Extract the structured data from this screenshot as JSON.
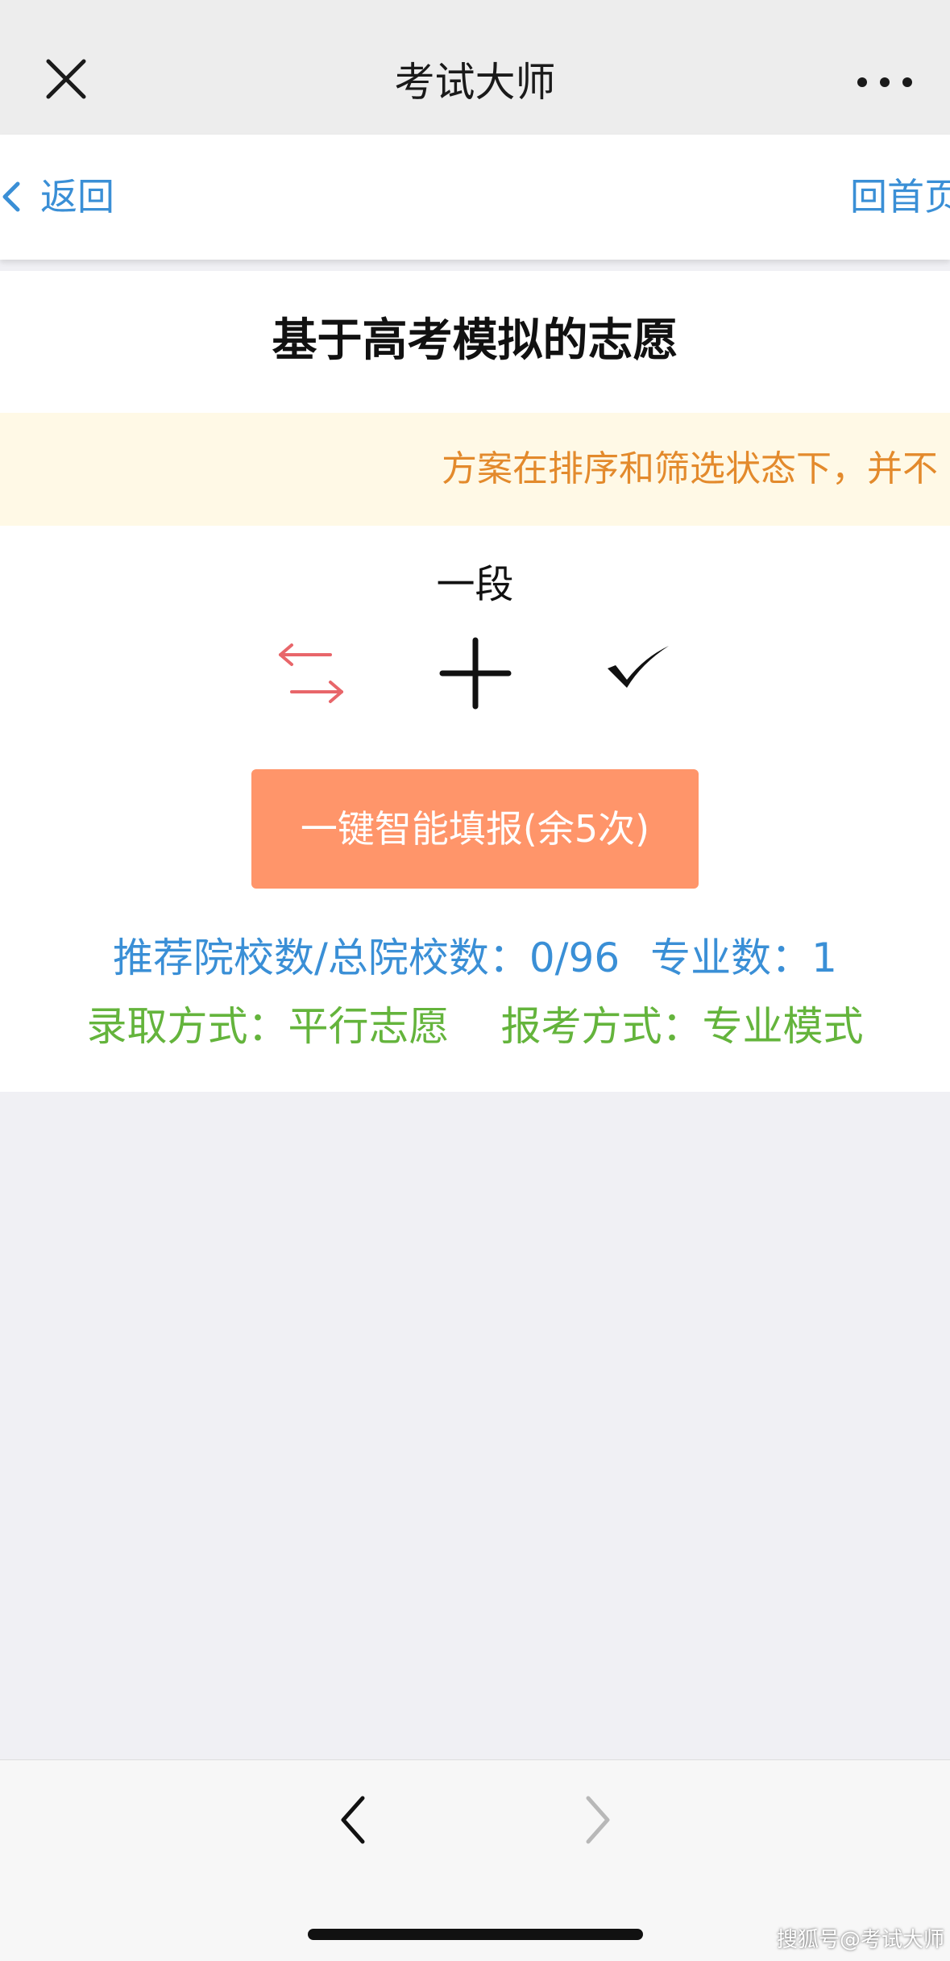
{
  "app": {
    "title": "考试大师",
    "close_icon": "close-icon",
    "more_icon": "more-dots-icon"
  },
  "nav": {
    "back_label": "返回",
    "home_label": "回首页"
  },
  "page": {
    "title": "基于高考模拟的志愿",
    "notice": "方案在排序和筛选状态下，并不",
    "segment": "一段"
  },
  "toolbar": {
    "icons": [
      "swap-icon",
      "add-icon",
      "check-icon"
    ],
    "swap_color": "#e8666a"
  },
  "smart_fill_button": "一键智能填报(余5次)",
  "stats": {
    "recommend_label": "推荐院校数/总院校数：",
    "recommend_value": "0/96",
    "major_label": "专业数：",
    "major_value": "1",
    "admission_label": "录取方式：",
    "admission_value": "平行志愿",
    "apply_label": "报考方式：",
    "apply_value": "专业模式"
  },
  "colors": {
    "accent_blue": "#3a8fd6",
    "accent_green": "#64b43c",
    "button_orange": "#ff956a",
    "notice_text": "#e38a2c",
    "notice_bg": "#fff9e6"
  },
  "watermark": "搜狐号@考试大师"
}
